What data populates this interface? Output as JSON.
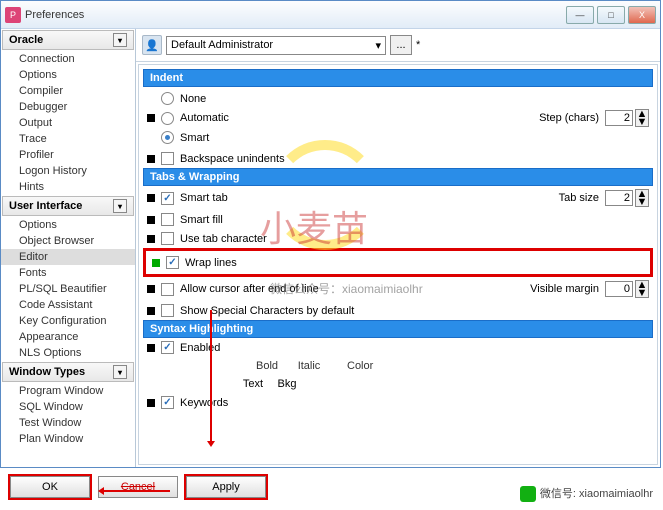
{
  "window": {
    "title": "Preferences"
  },
  "winbtns": {
    "min": "—",
    "max": "□",
    "close": "X"
  },
  "sidebar": {
    "groups": [
      {
        "label": "Oracle",
        "items": [
          "Connection",
          "Options",
          "Compiler",
          "Debugger",
          "Output",
          "Trace",
          "Profiler",
          "Logon History",
          "Hints"
        ]
      },
      {
        "label": "User Interface",
        "items": [
          "Options",
          "Object Browser",
          "Editor",
          "Fonts",
          "PL/SQL Beautifier",
          "Code Assistant",
          "Key Configuration",
          "Appearance",
          "NLS Options"
        ],
        "selected": 2
      },
      {
        "label": "Window Types",
        "items": [
          "Program Window",
          "SQL Window",
          "Test Window",
          "Plan Window"
        ]
      }
    ]
  },
  "toolbar": {
    "admin": "Default Administrator",
    "ellipsis": "...",
    "star": "*"
  },
  "sections": {
    "indent": {
      "title": "Indent",
      "opts": {
        "none": "None",
        "auto": "Automatic",
        "smart": "Smart"
      },
      "step_label": "Step (chars)",
      "step_val": "2",
      "backspace": "Backspace unindents"
    },
    "tabs": {
      "title": "Tabs & Wrapping",
      "smart_tab": "Smart tab",
      "tab_size_label": "Tab size",
      "tab_size_val": "2",
      "smart_fill": "Smart fill",
      "use_tab": "Use tab character",
      "wrap": "Wrap lines",
      "allow_cursor": "Allow cursor after end of line",
      "margin_label": "Visible margin",
      "margin_val": "0",
      "show_special": "Show Special Characters by default"
    },
    "syntax": {
      "title": "Syntax Highlighting",
      "enabled": "Enabled",
      "cols": {
        "bold": "Bold",
        "italic": "Italic",
        "text": "Text",
        "bkg": "Bkg",
        "color": "Color"
      },
      "keywords": "Keywords"
    }
  },
  "buttons": {
    "ok": "OK",
    "cancel": "Cancel",
    "apply": "Apply"
  },
  "watermark": {
    "main": "小麦苗",
    "sub": "微信公众号：xiaomaimiaolhr"
  },
  "footer": {
    "text": "微信号: xiaomaimiaolhr"
  }
}
